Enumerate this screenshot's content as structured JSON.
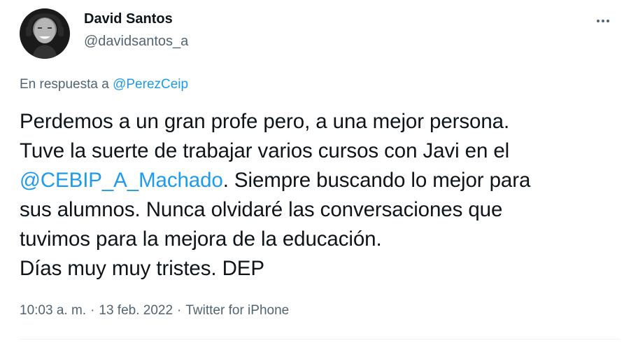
{
  "author": {
    "display_name": "David Santos",
    "handle": "@davidsantos_a"
  },
  "reply": {
    "prefix": "En respuesta a",
    "mention": "@PerezCeip"
  },
  "tweet": {
    "line1": "Perdemos a un gran profe pero, a una mejor persona.",
    "line2": "Tuve la suerte de trabajar varios cursos con Javi en el",
    "line3_mention": "@CEBIP_A_Machado",
    "line3_rest": ". Siempre buscando lo mejor para",
    "line4": "sus alumnos. Nunca olvidaré las conversaciones que",
    "line5": "tuvimos para la mejora de la educación.",
    "line6": "Días muy muy tristes. DEP"
  },
  "meta": {
    "time": "10:03 a. m.",
    "separator": "·",
    "date": "13 feb. 2022",
    "source": "Twitter for iPhone"
  },
  "icons": {
    "more": "more-horizontal-icon"
  },
  "colors": {
    "link": "#1d9bf0",
    "secondary_text": "#536471",
    "primary_text": "#0f1419"
  }
}
